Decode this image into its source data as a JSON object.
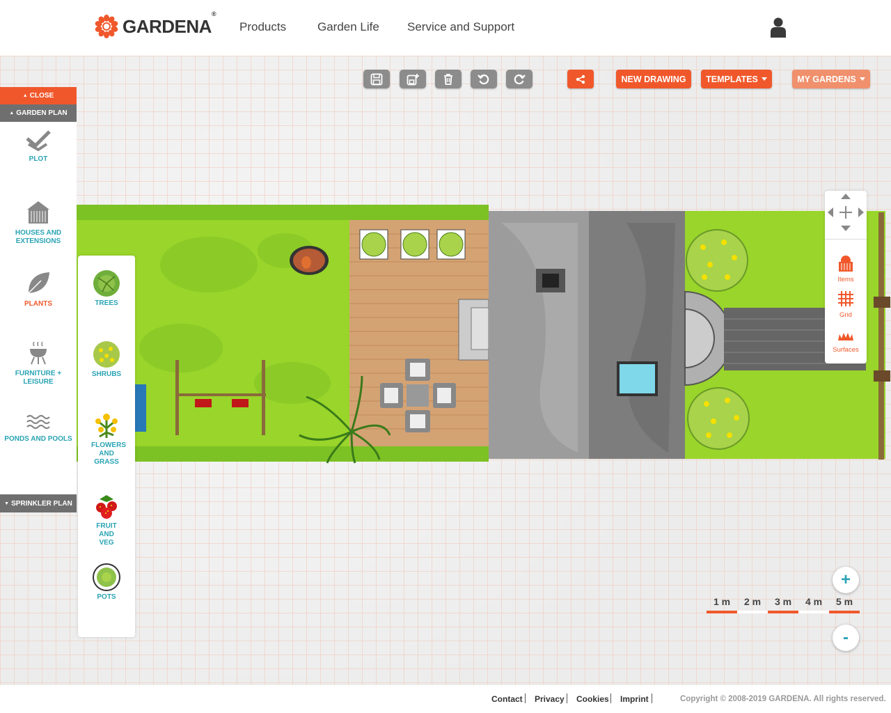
{
  "header": {
    "logo_text": "GARDENA",
    "logo_reg": "®",
    "nav": [
      "Products",
      "Garden Life",
      "Service and Support"
    ]
  },
  "toolbar": {
    "icons": [
      "save-icon",
      "save-as-icon",
      "trash-icon",
      "undo-icon",
      "redo-icon",
      "share-icon"
    ],
    "new_drawing": "NEW DRAWING",
    "templates": "TEMPLATES",
    "my_gardens": "MY GARDENS"
  },
  "left_panel": {
    "close": "CLOSE",
    "garden_plan": "GARDEN PLAN",
    "categories": [
      {
        "label": "PLOT",
        "icon": "plot-icon"
      },
      {
        "label": "HOUSES AND EXTENSIONS",
        "icon": "house-icon"
      },
      {
        "label": "PLANTS",
        "icon": "leaf-icon",
        "active": true
      },
      {
        "label": "FURNITURE + LEISURE",
        "icon": "grill-icon"
      },
      {
        "label": "PONDS AND POOLS",
        "icon": "water-icon"
      }
    ],
    "sprinkler_plan": "SPRINKLER PLAN"
  },
  "sub_panel": {
    "items": [
      {
        "label": "TREES",
        "icon": "tree-icon"
      },
      {
        "label": "SHRUBS",
        "icon": "shrub-icon"
      },
      {
        "label": "FLOWERS AND GRASS",
        "icon": "flower-icon"
      },
      {
        "label": "FRUIT AND VEG",
        "icon": "strawberry-icon"
      },
      {
        "label": "POTS",
        "icon": "pot-icon"
      }
    ]
  },
  "right_panel": {
    "items": [
      {
        "label": "Items",
        "icon": "items-icon"
      },
      {
        "label": "Grid",
        "icon": "grid-icon"
      },
      {
        "label": "Surfaces",
        "icon": "surfaces-icon"
      }
    ]
  },
  "zoom": {
    "plus": "+",
    "minus": "-"
  },
  "scale": {
    "labels": [
      "1 m",
      "2 m",
      "3 m",
      "4 m",
      "5 m"
    ],
    "colors": [
      "#f0582b",
      "#ffffff",
      "#f0582b",
      "#ffffff",
      "#f0582b"
    ]
  },
  "footer": {
    "links": [
      "Contact",
      "Privacy",
      "Cookies",
      "Imprint"
    ],
    "copyright": "Copyright © 2008-2019 GARDENA. All rights reserved."
  },
  "colors": {
    "accent": "#f0582b",
    "teal": "#2aa4b4",
    "grass": "#99d52a"
  }
}
